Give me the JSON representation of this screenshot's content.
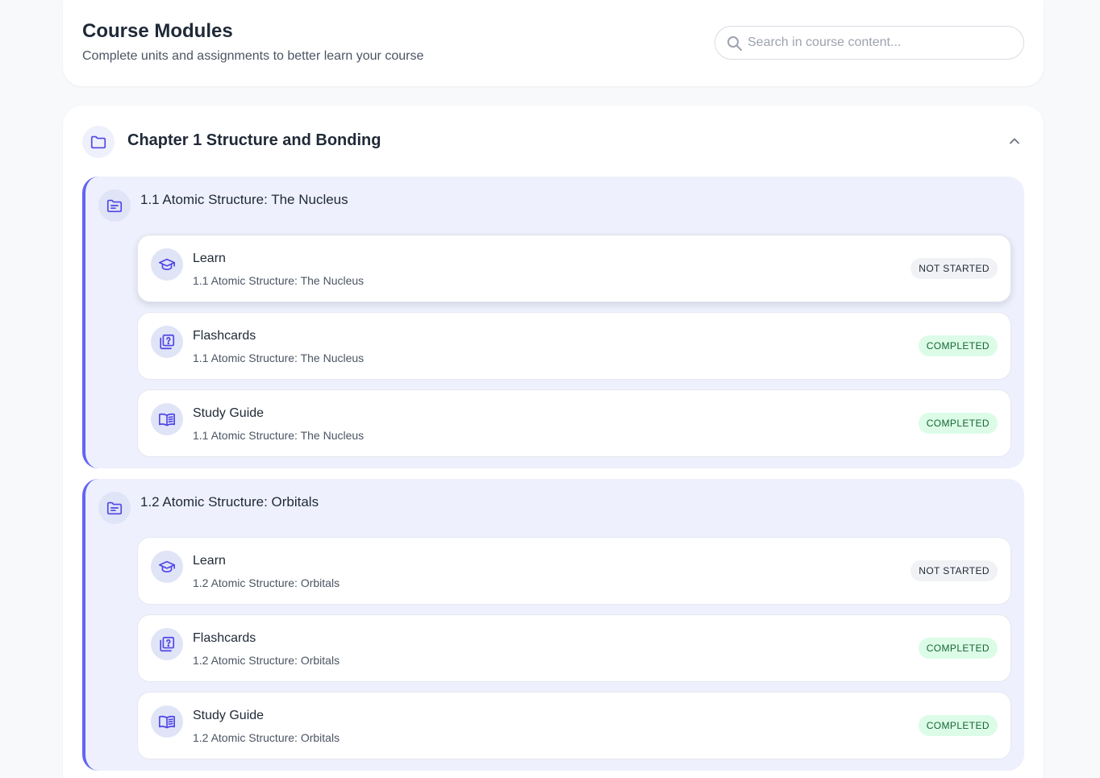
{
  "header": {
    "title": "Course Modules",
    "subtitle": "Complete units and assignments to better learn your course",
    "search_placeholder": "Search in course content..."
  },
  "colors": {
    "accent": "#6366f1",
    "section_bg": "#eef0fd",
    "completed_bg": "#dcfce7",
    "completed_text": "#166534",
    "not_started_bg": "#f1f2f5"
  },
  "chapter": {
    "title": "Chapter 1 Structure and Bonding",
    "icon": "folder-icon",
    "expanded": true,
    "sections": [
      {
        "title": "1.1 Atomic Structure: The Nucleus",
        "icon": "folder-open-icon",
        "items": [
          {
            "title": "Learn",
            "subtitle": "1.1 Atomic Structure: The Nucleus",
            "status": "NOT STARTED",
            "icon": "graduation-cap-icon"
          },
          {
            "title": "Flashcards",
            "subtitle": "1.1 Atomic Structure: The Nucleus",
            "status": "COMPLETED",
            "icon": "flashcards-icon"
          },
          {
            "title": "Study Guide",
            "subtitle": "1.1 Atomic Structure: The Nucleus",
            "status": "COMPLETED",
            "icon": "book-open-icon"
          }
        ]
      },
      {
        "title": "1.2 Atomic Structure: Orbitals",
        "icon": "folder-open-icon",
        "items": [
          {
            "title": "Learn",
            "subtitle": "1.2 Atomic Structure: Orbitals",
            "status": "NOT STARTED",
            "icon": "graduation-cap-icon"
          },
          {
            "title": "Flashcards",
            "subtitle": "1.2 Atomic Structure: Orbitals",
            "status": "COMPLETED",
            "icon": "flashcards-icon"
          },
          {
            "title": "Study Guide",
            "subtitle": "1.2 Atomic Structure: Orbitals",
            "status": "COMPLETED",
            "icon": "book-open-icon"
          }
        ]
      }
    ]
  }
}
